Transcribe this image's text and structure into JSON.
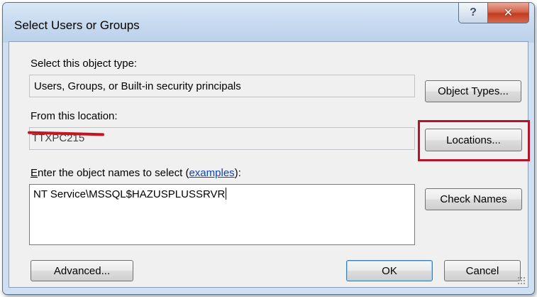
{
  "window": {
    "title": "Select Users or Groups"
  },
  "caption": {
    "help_glyph": "?",
    "close_glyph": "✕"
  },
  "object_type": {
    "label": "Select this object type:",
    "value": "Users, Groups, or Built-in security principals",
    "button": "Object Types..."
  },
  "location": {
    "label": "From this location:",
    "value": "TTXPC215",
    "button": "Locations..."
  },
  "names": {
    "label_prefix": "E",
    "label_rest": "nter the object names to select (",
    "link": "examples",
    "label_suffix": "):",
    "value": "NT Service\\MSSQL$HAZUSPLUSSRVR",
    "check_button": "Check Names"
  },
  "footer": {
    "advanced_button": "Advanced...",
    "ok_button": "OK",
    "cancel_button": "Cancel"
  },
  "colors": {
    "highlight": "#b5152b",
    "link": "#0b45b8",
    "close": "#c13c21"
  }
}
